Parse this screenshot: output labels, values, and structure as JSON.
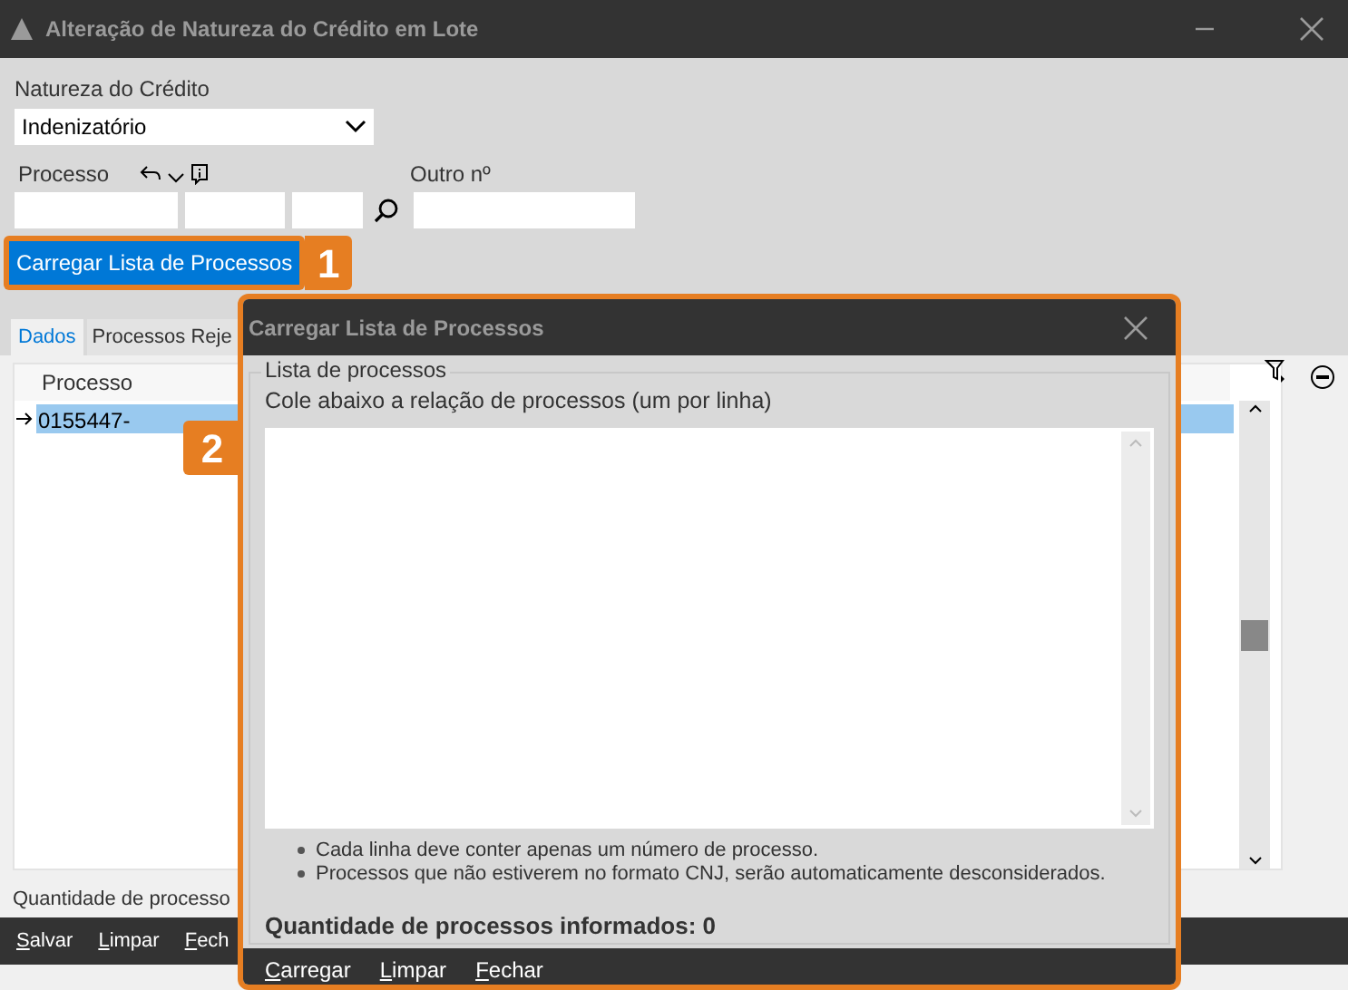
{
  "window": {
    "title": "Alteração de Natureza do Crédito em Lote"
  },
  "natureza": {
    "label": "Natureza do Crédito",
    "value": "Indenizatório"
  },
  "processo": {
    "label": "Processo",
    "outro_label": "Outro nº"
  },
  "load_button": {
    "label": "Carregar Lista de Processos",
    "badge": "1"
  },
  "tabs": [
    {
      "label": "Dados",
      "selected": true
    },
    {
      "label": "Processos Reje",
      "selected": false
    }
  ],
  "grid": {
    "column": "Processo",
    "rows": [
      {
        "value": "0155447-",
        "selected": true
      }
    ]
  },
  "count_label": "Quantidade de processo",
  "footer_buttons": [
    "Salvar",
    "Limpar",
    "Fech"
  ],
  "dialog": {
    "title": "Carregar Lista de Processos",
    "badge": "2",
    "group": "Lista de processos",
    "instruction": "Cole abaixo a relação de processos (um por linha)",
    "notes": [
      "Cada linha deve conter apenas um número de processo.",
      "Processos que não estiverem no formato CNJ, serão automaticamente desconsiderados."
    ],
    "count": "Quantidade de processos informados: 0",
    "buttons": [
      "Carregar",
      "Limpar",
      "Fechar"
    ]
  }
}
